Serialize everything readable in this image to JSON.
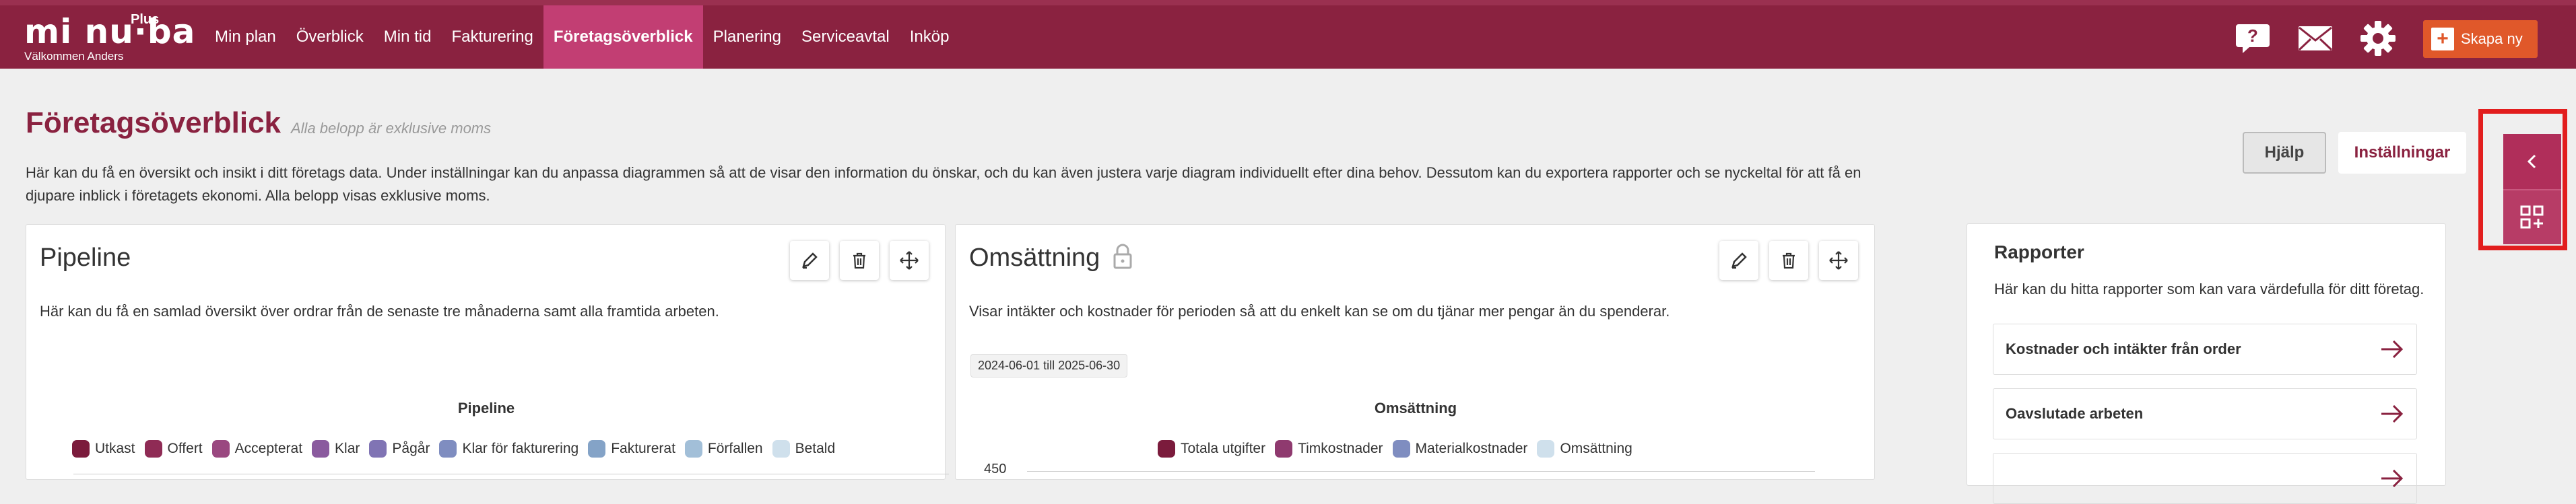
{
  "header": {
    "logo_text": "mi nu·ba",
    "logo_plus": "Plus",
    "welcome": "Välkommen Anders",
    "nav": [
      "Min plan",
      "Överblick",
      "Min tid",
      "Fakturering",
      "Företagsöverblick",
      "Planering",
      "Serviceavtal",
      "Inköp"
    ],
    "active_nav": "Företagsöverblick",
    "icons": [
      "help-icon",
      "mail-icon",
      "gear-icon"
    ],
    "create_label": "Skapa ny"
  },
  "page": {
    "title": "Företagsöverblick",
    "subtitle": "Alla belopp är exklusive moms",
    "description": "Här kan du få en översikt och insikt i ditt företags data. Under inställningar kan du anpassa diagrammen så att de visar den information du önskar, och du kan även justera varje diagram individuellt efter dina behov. Dessutom kan du exportera rapporter och se nyckeltal för att få en djupare inblick i företagets ekonomi. Alla belopp visas exklusive moms.",
    "help_label": "Hjälp",
    "settings_label": "Inställningar"
  },
  "pipeline": {
    "title": "Pipeline",
    "description": "Här kan du få en samlad översikt över ordrar från de senaste tre månaderna samt alla framtida arbeten.",
    "chart_title": "Pipeline",
    "legend": [
      {
        "label": "Utkast",
        "color": "#7b1b3c"
      },
      {
        "label": "Offert",
        "color": "#8f2b55"
      },
      {
        "label": "Accepterat",
        "color": "#9a4880"
      },
      {
        "label": "Klar",
        "color": "#8a5a9e"
      },
      {
        "label": "Pågår",
        "color": "#8074b4"
      },
      {
        "label": "Klar för fakturering",
        "color": "#7f8dc0"
      },
      {
        "label": "Fakturerat",
        "color": "#84a3c7"
      },
      {
        "label": "Förfallen",
        "color": "#a2bfd8"
      },
      {
        "label": "Betald",
        "color": "#cfe0ec"
      }
    ]
  },
  "omsattning": {
    "title": "Omsättning",
    "description": "Visar intäkter och kostnader för perioden så att du enkelt kan se om du tjänar mer pengar än du spenderar.",
    "date_range": "2024-06-01 till 2025-06-30",
    "chart_title": "Omsättning",
    "legend": [
      {
        "label": "Totala utgifter",
        "color": "#7b1b3c"
      },
      {
        "label": "Timkostnader",
        "color": "#8f3a6f"
      },
      {
        "label": "Materialkostnader",
        "color": "#7f8dc0"
      },
      {
        "label": "Omsättning",
        "color": "#cfe0ec"
      }
    ],
    "y_tick_top": "450"
  },
  "reports": {
    "title": "Rapporter",
    "description": "Här kan du hitta rapporter som kan vara värdefulla för ditt företag.",
    "items": [
      "Kostnader och intäkter från order",
      "Oavslutade arbeten"
    ]
  }
}
